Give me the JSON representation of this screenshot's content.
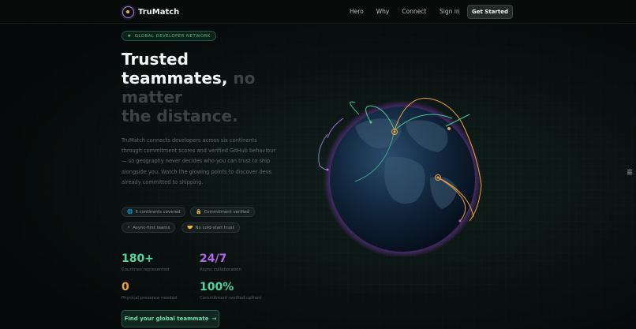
{
  "brand": {
    "name": "TruMatch",
    "icon": "globe-logo-icon"
  },
  "nav": {
    "items": [
      "Hero",
      "Why",
      "Connect"
    ],
    "sign_in": "Sign in",
    "cta": "Get Started"
  },
  "hero": {
    "badge": "GLOBAL DEVELOPER NETWORK",
    "headline_l1": "Trusted",
    "headline_l2a": "teammates,",
    "headline_l2b": "no",
    "headline_l3": "matter",
    "headline_l4": "the distance.",
    "description": "TruMatch connects developers across six continents through commitment scores and verified GitHub behaviour — so geography never decides who you can trust to ship alongside you. Watch the glowing points to discover devs already committed to shipping."
  },
  "chips": [
    {
      "icon": "🌐",
      "label": "6 continents covered"
    },
    {
      "icon": "🔒",
      "label": "Commitment verified"
    },
    {
      "icon": "⚡",
      "label": "Async-first teams"
    },
    {
      "icon": "🤝",
      "label": "No cold-start trust"
    }
  ],
  "stats": [
    {
      "value": "180+",
      "label": "Countries represented",
      "color": "#4fd6a0"
    },
    {
      "value": "24/7",
      "label": "Async collaboration",
      "color": "#b267e6"
    },
    {
      "value": "0",
      "label": "Physical presence needed",
      "color": "#f2a13a"
    },
    {
      "value": "100%",
      "label": "Commitment verified upfront",
      "color": "#4fd6a0"
    }
  ],
  "cta": {
    "label": "Find your global teammate",
    "arrow": "→"
  },
  "colors": {
    "accent_green": "#49c992",
    "accent_purple": "#b267e6",
    "accent_orange": "#f2a13a",
    "background": "#0a100f"
  }
}
